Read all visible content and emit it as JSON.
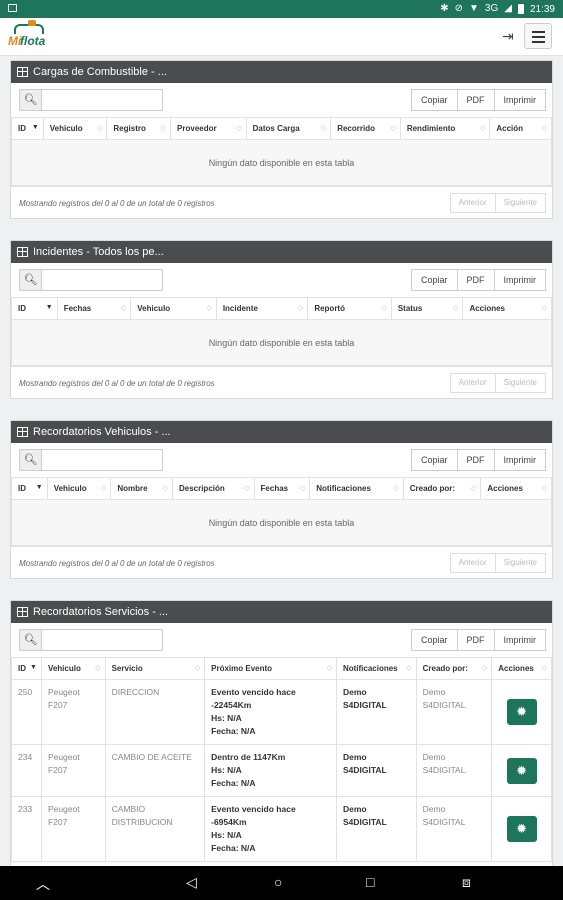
{
  "status_bar": {
    "time": "21:39",
    "network": "3G"
  },
  "app": {
    "logo_mi": "Mi",
    "logo_flota": "flota"
  },
  "toolbar_buttons": [
    "Copiar",
    "PDF",
    "Imprimir"
  ],
  "pager": {
    "prev": "Anterior",
    "next": "Siguiente"
  },
  "empty_text": "Ningún dato disponible en esta tabla",
  "info_text": "Mostrando registros del 0 al 0 de un total de 0 registros",
  "panels": [
    {
      "title": "Cargas de Combustible - ...",
      "columns": [
        "ID",
        "Vehiculo",
        "Registro",
        "Proveedor",
        "Datos Carga",
        "Recorrido",
        "Rendimiento",
        "Acción"
      ]
    },
    {
      "title": "Incidentes - Todos los pe...",
      "columns": [
        "ID",
        "Fechas",
        "Vehiculo",
        "Incidente",
        "Reportó",
        "Status",
        "Acciones"
      ]
    },
    {
      "title": "Recordatorios Vehiculos - ...",
      "columns": [
        "ID",
        "Vehiculo",
        "Nombre",
        "Descripción",
        "Fechas",
        "Notificaciones",
        "Creado por:",
        "Acciones"
      ]
    },
    {
      "title": "Recordatorios Servicios - ...",
      "columns": [
        "ID",
        "Vehiculo",
        "Servicio",
        "Próximo Evento",
        "Notificaciones",
        "Creado por:",
        "Acciones"
      ],
      "rows": [
        {
          "id": "250",
          "vehiculo": [
            "Peugeot",
            "F207"
          ],
          "servicio": [
            "DIRECCION"
          ],
          "evento": [
            "Evento vencido hace",
            "-22454Km",
            "Hs: N/A",
            "Fecha: N/A"
          ],
          "notificaciones": [
            "Demo",
            "S4DIGITAL"
          ],
          "creado": [
            "Demo",
            "S4DIGITAL"
          ]
        },
        {
          "id": "234",
          "vehiculo": [
            "Peugeot",
            "F207"
          ],
          "servicio": [
            "CAMBIO DE ACEITE"
          ],
          "evento": [
            "Dentro de 1147Km",
            "Hs: N/A",
            "Fecha: N/A"
          ],
          "notificaciones": [
            "Demo",
            "S4DIGITAL"
          ],
          "creado": [
            "Demo",
            "S4DIGITAL"
          ]
        },
        {
          "id": "233",
          "vehiculo": [
            "Peugeot",
            "F207"
          ],
          "servicio": [
            "CAMBIO",
            "DISTRIBUCION"
          ],
          "evento": [
            "Evento vencido hace",
            "-6954Km",
            "Hs: N/A",
            "Fecha: N/A"
          ],
          "notificaciones": [
            "Demo",
            "S4DIGITAL"
          ],
          "creado": [
            "Demo",
            "S4DIGITAL"
          ]
        }
      ]
    }
  ],
  "colors": {
    "brand_green": "#1e7559",
    "panel_header": "#4a4c4f",
    "logo_orange": "#e08a1e"
  }
}
